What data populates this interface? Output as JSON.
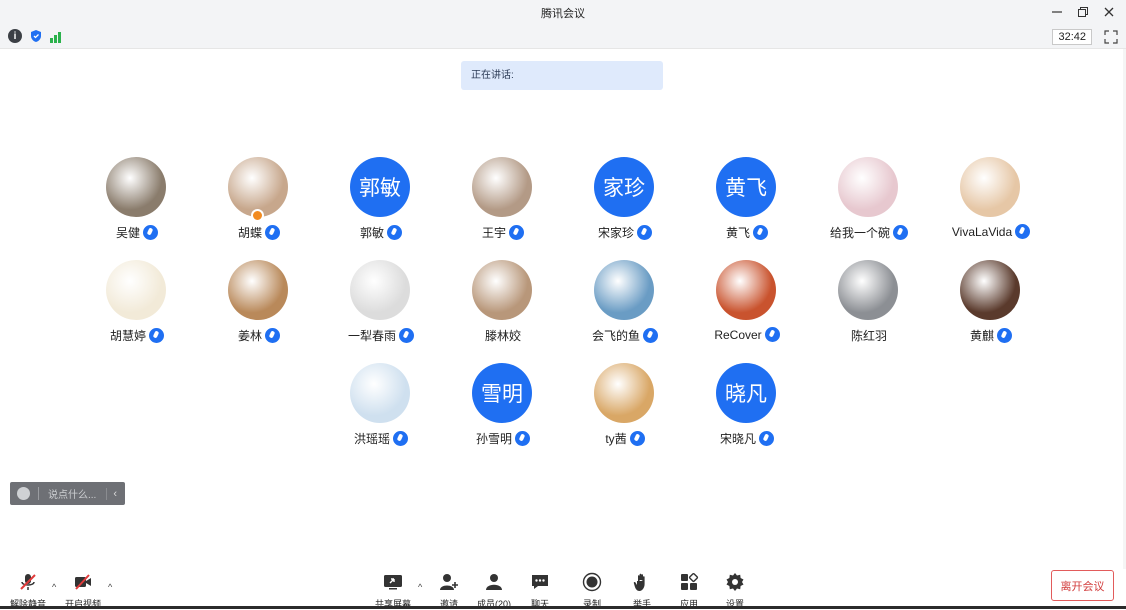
{
  "window": {
    "title": "腾讯会议"
  },
  "info": {
    "timer": "32:42"
  },
  "speaking": {
    "label": "正在讲话:"
  },
  "participants": [
    {
      "name": "吴健",
      "avatar": "photo",
      "color": "#8a7c6c",
      "mic": true
    },
    {
      "name": "胡蝶",
      "avatar": "photo",
      "color": "#c7a78c",
      "mic": true,
      "host": true
    },
    {
      "name": "郭敏",
      "avatar": "text",
      "avatar_text": "郭敏",
      "mic": true
    },
    {
      "name": "王宇",
      "avatar": "photo",
      "color": "#b39a86",
      "mic": true
    },
    {
      "name": "宋家珍",
      "avatar": "text",
      "avatar_text": "家珍",
      "mic": true
    },
    {
      "name": "黄飞",
      "avatar": "text",
      "avatar_text": "黄飞",
      "mic": true
    },
    {
      "name": "给我一个碗",
      "avatar": "photo",
      "color": "#e7c8cf",
      "mic": true
    },
    {
      "name": "VivaLaVida",
      "avatar": "photo",
      "color": "#e6c7a6",
      "mic": true
    },
    {
      "name": "胡慧婷",
      "avatar": "photo",
      "color": "#f2ead8",
      "mic": true
    },
    {
      "name": "姜林",
      "avatar": "photo",
      "color": "#b9895a",
      "mic": true
    },
    {
      "name": "一犁春雨",
      "avatar": "photo",
      "color": "#dcdcdc",
      "mic": true
    },
    {
      "name": "滕林姣",
      "avatar": "photo",
      "color": "#b8977a",
      "mic": false
    },
    {
      "name": "会飞的鱼",
      "avatar": "photo",
      "color": "#6a9cc4",
      "mic": true
    },
    {
      "name": "ReCover",
      "avatar": "photo",
      "color": "#c9532e",
      "mic": true
    },
    {
      "name": "陈红羽",
      "avatar": "photo",
      "color": "#8c8f94",
      "mic": false
    },
    {
      "name": "黄麒",
      "avatar": "photo",
      "color": "#5a3a2c",
      "mic": true
    },
    {
      "name": "洪瑶瑶",
      "avatar": "photo",
      "color": "#cfe0ef",
      "mic": true
    },
    {
      "name": "孙雪明",
      "avatar": "text",
      "avatar_text": "雪明",
      "mic": true
    },
    {
      "name": "ty茜",
      "avatar": "photo",
      "color": "#d9a766",
      "mic": true
    },
    {
      "name": "宋晓凡",
      "avatar": "text",
      "avatar_text": "晓凡",
      "mic": true
    }
  ],
  "chat": {
    "placeholder": "说点什么..."
  },
  "toolbar": {
    "unmute": "解除静音",
    "video": "开启视频",
    "share": "共享屏幕",
    "invite": "邀请",
    "members": "成员(20)",
    "chat": "聊天",
    "record": "录制",
    "raise_hand": "举手",
    "apps": "应用",
    "settings": "设置",
    "leave": "离开会议"
  },
  "colors": {
    "accent": "#1f6ff2",
    "leave": "#d23c3c"
  }
}
